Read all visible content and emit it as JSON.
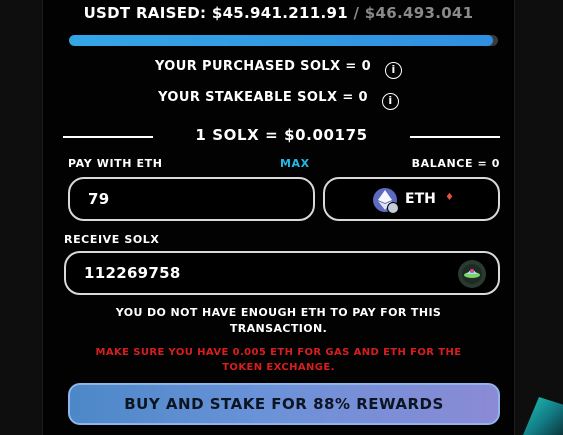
{
  "raised": {
    "label": "USDT RAISED:",
    "amount": "$45.941.211.91",
    "separator": "/",
    "target": "$46.493.041"
  },
  "progress": {
    "fraction": 0.988,
    "color": "#34a6e6"
  },
  "purchased": {
    "label": "YOUR PURCHASED SOLX = 0",
    "icon": "info-icon"
  },
  "stakeable": {
    "label": "YOUR STAKEABLE SOLX = 0",
    "icon": "info-icon"
  },
  "price": {
    "label": "1 SOLX = $0.00175"
  },
  "pay": {
    "label": "PAY WITH ETH",
    "max_label": "MAX",
    "balance_label": "BALANCE = 0",
    "value": "79",
    "currency": "ETH",
    "currency_icon": "ethereum-icon",
    "caret_icon": "chevron-down-icon"
  },
  "receive": {
    "label": "RECEIVE SOLX",
    "value": "112269758",
    "token_icon": "solx-token-icon"
  },
  "messages": {
    "warning_line1": "YOU DO NOT HAVE ENOUGH ETH TO PAY FOR THIS",
    "warning_line2": "TRANSACTION.",
    "gas_line1": "MAKE SURE YOU HAVE 0.005 ETH FOR GAS AND ETH FOR THE",
    "gas_line2": "TOKEN EXCHANGE."
  },
  "buy_button": {
    "label": "BUY AND STAKE FOR 88% REWARDS"
  },
  "colors": {
    "accent": "#22b8e8",
    "error": "#d81e1e",
    "button": "#6a92d8"
  }
}
